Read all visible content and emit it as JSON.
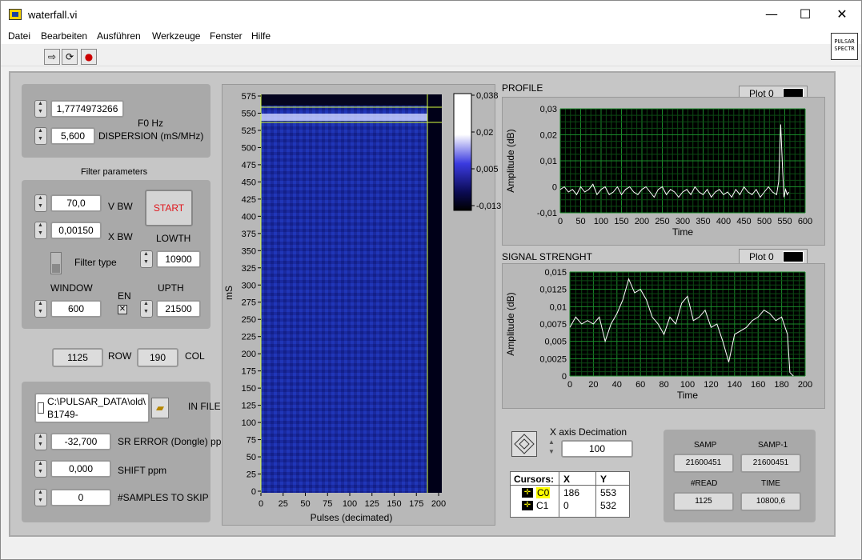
{
  "window": {
    "title": "waterfall.vi",
    "minimize": "—",
    "maximize": "☐",
    "close": "✕"
  },
  "menu": [
    "Datei",
    "Bearbeiten",
    "Ausführen",
    "Werkzeuge",
    "Fenster",
    "Hilfe"
  ],
  "toolbar": {
    "run": "⇨",
    "run_continuous": "⟳",
    "abort": "●"
  },
  "vi_icon_text": [
    "PULSAR",
    "SPECTR"
  ],
  "controls": {
    "f0": {
      "label": "F0 Hz",
      "value": "1,7774973266"
    },
    "dispersion": {
      "label": "DISPERSION (mS/MHz)",
      "value": "5,600"
    },
    "filter_params_label": "Filter parameters",
    "vbw": {
      "label": "V BW",
      "value": "70,0"
    },
    "xbw": {
      "label": "X BW",
      "value": "0,00150"
    },
    "start_button": "START",
    "filter_type_label": "Filter type",
    "lowth": {
      "label": "LOWTH",
      "value": "10900"
    },
    "window": {
      "label": "WINDOW",
      "value": "600"
    },
    "en_label": "EN",
    "upth": {
      "label": "UPTH",
      "value": "21500"
    },
    "row": {
      "label": "ROW",
      "value": "1125"
    },
    "col": {
      "label": "COL",
      "value": "190"
    },
    "infile": {
      "label": "IN FILE",
      "line1": "C:\\PULSAR_DATA\\old\\",
      "line2": "B1749-"
    },
    "sr_error": {
      "label": "SR ERROR (Dongle) ppm",
      "value": "-32,700"
    },
    "shift": {
      "label": "SHIFT ppm",
      "value": "0,000"
    },
    "skip": {
      "label": "#SAMPLES TO SKIP",
      "value": "0"
    }
  },
  "waterfall": {
    "ylabel": "mS",
    "xlabel": "Pulses (decimated)",
    "y_ticks": [
      "575",
      "550",
      "525",
      "500",
      "475",
      "450",
      "425",
      "400",
      "375",
      "350",
      "325",
      "300",
      "275",
      "250",
      "225",
      "200",
      "175",
      "150",
      "125",
      "100",
      "75",
      "50",
      "25",
      "0"
    ],
    "x_ticks": [
      "0",
      "25",
      "50",
      "75",
      "100",
      "125",
      "150",
      "175",
      "200"
    ],
    "colorbar_ticks": [
      "0,038",
      "0,02",
      "0,005",
      "-0,013"
    ]
  },
  "profile": {
    "title": "PROFILE",
    "legend": "Plot 0",
    "xlabel": "Time",
    "ylabel": "Amplitude (dB)",
    "y_ticks": [
      "0,03",
      "0,02",
      "0,01",
      "0",
      "-0,01"
    ],
    "x_ticks": [
      "0",
      "50",
      "100",
      "150",
      "200",
      "250",
      "300",
      "350",
      "400",
      "450",
      "500",
      "550",
      "600"
    ]
  },
  "signal": {
    "title": "SIGNAL STRENGHT",
    "legend": "Plot 0",
    "xlabel": "Time",
    "ylabel": "Amplitude (dB)",
    "y_ticks": [
      "0,015",
      "0,0125",
      "0,01",
      "0,0075",
      "0,005",
      "0,0025",
      "0"
    ],
    "x_ticks": [
      "0",
      "20",
      "40",
      "60",
      "80",
      "100",
      "120",
      "140",
      "160",
      "180",
      "200"
    ]
  },
  "decimation": {
    "label": "X axis Decimation",
    "value": "100"
  },
  "cursors": {
    "header": [
      "Cursors:",
      "X",
      "Y"
    ],
    "rows": [
      {
        "name": "C0",
        "x": "186",
        "y": "553"
      },
      {
        "name": "C1",
        "x": "0",
        "y": "532"
      }
    ]
  },
  "stats": {
    "samp": {
      "label": "SAMP",
      "value": "21600451"
    },
    "samp1": {
      "label": "SAMP-1",
      "value": "21600451"
    },
    "read": {
      "label": "#READ",
      "value": "1125"
    },
    "time": {
      "label": "TIME",
      "value": "10800,6"
    }
  },
  "chart_data": [
    {
      "type": "line",
      "title": "PROFILE",
      "xlabel": "Time",
      "ylabel": "Amplitude (dB)",
      "xlim": [
        0,
        600
      ],
      "ylim": [
        -0.01,
        0.03
      ],
      "series": [
        {
          "x": [
            0,
            10,
            20,
            30,
            40,
            50,
            60,
            70,
            80,
            90,
            100,
            110,
            120,
            130,
            140,
            150,
            160,
            170,
            180,
            190,
            200,
            210,
            220,
            230,
            240,
            250,
            260,
            270,
            280,
            290,
            300,
            310,
            320,
            330,
            340,
            350,
            360,
            370,
            380,
            390,
            400,
            410,
            420,
            430,
            440,
            450,
            460,
            470,
            480,
            490,
            500,
            510,
            520,
            530,
            535,
            540,
            545,
            548,
            552,
            556,
            560
          ],
          "y": [
            -0.001,
            0.0,
            -0.002,
            -0.001,
            -0.003,
            0.0,
            -0.002,
            -0.001,
            0.001,
            -0.003,
            -0.001,
            0.0,
            -0.003,
            -0.002,
            0.0,
            -0.003,
            -0.001,
            0.0,
            -0.002,
            -0.003,
            -0.001,
            0.0,
            -0.002,
            -0.004,
            -0.001,
            0.0,
            -0.003,
            -0.001,
            -0.002,
            -0.004,
            -0.002,
            -0.001,
            -0.003,
            0.0,
            -0.002,
            -0.003,
            -0.001,
            -0.004,
            -0.002,
            -0.001,
            -0.003,
            -0.002,
            -0.004,
            -0.001,
            -0.003,
            0.0,
            -0.002,
            -0.003,
            -0.001,
            -0.004,
            -0.002,
            0.0,
            -0.002,
            -0.003,
            0.002,
            0.024,
            0.006,
            -0.004,
            -0.001,
            -0.003,
            -0.002
          ]
        }
      ]
    },
    {
      "type": "line",
      "title": "SIGNAL STRENGHT",
      "xlabel": "Time",
      "ylabel": "Amplitude (dB)",
      "xlim": [
        0,
        200
      ],
      "ylim": [
        0,
        0.015
      ],
      "series": [
        {
          "x": [
            0,
            5,
            10,
            15,
            20,
            25,
            30,
            35,
            40,
            45,
            50,
            55,
            60,
            65,
            70,
            75,
            80,
            85,
            90,
            95,
            100,
            105,
            110,
            115,
            120,
            125,
            130,
            135,
            140,
            145,
            150,
            155,
            160,
            165,
            170,
            175,
            180,
            185,
            187,
            190
          ],
          "y": [
            0.007,
            0.0085,
            0.0075,
            0.008,
            0.0075,
            0.0085,
            0.005,
            0.0075,
            0.009,
            0.011,
            0.014,
            0.012,
            0.0125,
            0.011,
            0.0085,
            0.0075,
            0.006,
            0.0085,
            0.0075,
            0.0105,
            0.0115,
            0.008,
            0.0085,
            0.0095,
            0.007,
            0.0075,
            0.005,
            0.002,
            0.006,
            0.0065,
            0.007,
            0.008,
            0.0085,
            0.0095,
            0.009,
            0.008,
            0.0085,
            0.006,
            0.0005,
            0.0
          ]
        }
      ]
    }
  ]
}
